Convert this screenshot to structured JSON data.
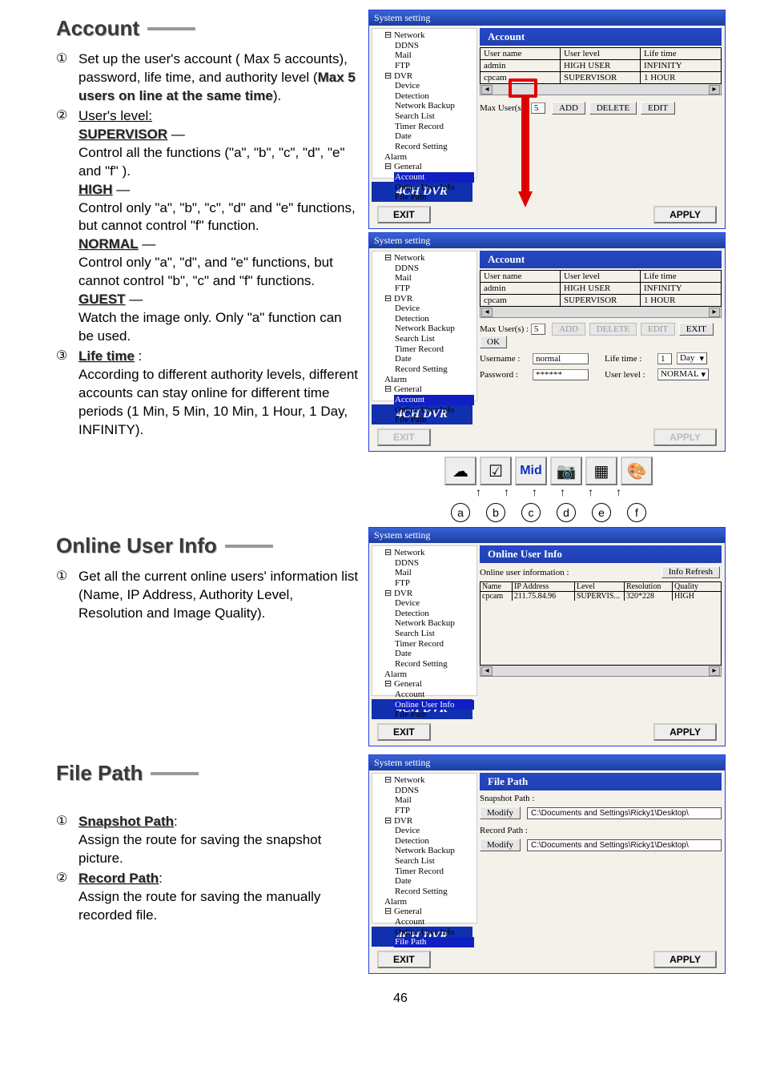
{
  "page_number": "46",
  "account": {
    "title": "Account",
    "item1_num": "①",
    "item1": "Set up the user's account ( Max 5 accounts), password, life time, and authority level (Max 5 users on line at the same time).",
    "item2_num": "②",
    "item2_intro": "User's level:",
    "supervisor_label": "SUPERVISOR",
    "supervisor_body": "Control all the functions (\"a\", \"b\", \"c\", \"d\", \"e\" and \"f\" ).",
    "high_label": "HIGH",
    "high_body": "Control only \"a\", \"b\", \"c\", \"d\" and \"e\" functions, but cannot control \"f\" function.",
    "normal_label": "NORMAL",
    "normal_body": "Control only \"a\", \"d\", and \"e\" functions, but cannot control \"b\", \"c\" and \"f\" functions.",
    "guest_label": "GUEST",
    "guest_body": "Watch the image only. Only \"a\" function can be used.",
    "item3_num": "③",
    "item3_label": "Life time",
    "item3_body": "According to different authority levels, different accounts can stay online for different time periods (1 Min, 5 Min, 10 Min, 1 Hour, 1 Day, INFINITY).",
    "dash": "—"
  },
  "online": {
    "title": "Online User Info",
    "item1_num": "①",
    "item1": "Get all the current online users' information list (Name, IP Address, Authority Level, Resolution and Image Quality)."
  },
  "filepath": {
    "title": "File Path",
    "item1_num": "①",
    "item1_label": "Snapshot Path",
    "item1_body": "Assign the route for saving the snapshot picture.",
    "item2_num": "②",
    "item2_label": "Record Path",
    "item2_body": "Assign the route for saving the manually recorded file."
  },
  "dlg": {
    "window_title": "System setting",
    "logo": "4CH DVR",
    "exit": "EXIT",
    "apply": "APPLY",
    "add": "ADD",
    "delete": "DELETE",
    "edit": "EDIT",
    "ok": "OK",
    "modify": "Modify",
    "info_refresh": "Info Refresh"
  },
  "tree": {
    "network": "Network",
    "ddns": "DDNS",
    "mail": "Mail",
    "ftp": "FTP",
    "dvr": "DVR",
    "device": "Device",
    "detection": "Detection",
    "network_backup": "Network Backup",
    "search_list": "Search List",
    "timer_record": "Timer Record",
    "date": "Date",
    "record_setting": "Record Setting",
    "alarm": "Alarm",
    "general": "General",
    "account": "Account",
    "online_user_info": "Online User Info",
    "file_path": "File Path"
  },
  "account_pane": {
    "title": "Account",
    "col_user": "User name",
    "col_level": "User level",
    "col_life": "Life time",
    "row1_user": "admin",
    "row1_level": "HIGH USER",
    "row1_life": "INFINITY",
    "row2_user": "cpcam",
    "row2_level": "SUPERVISOR",
    "row2_life": "1 HOUR",
    "max_user_label": "Max User(s) :",
    "max_user_value": "5",
    "username_label": "Username :",
    "username_value": "normal",
    "lifetime_label": "Life time :",
    "lifetime_value": "1",
    "lifetime_unit": "Day",
    "password_label": "Password :",
    "password_value": "******",
    "userlevel_label": "User level :",
    "userlevel_value": "NORMAL"
  },
  "online_pane": {
    "title": "Online User Info",
    "info_label": "Online user information :",
    "col_name": "Name",
    "col_ip": "IP Address",
    "col_level": "Level",
    "col_res": "Resolution",
    "col_quality": "Quality",
    "row1_name": "cpcam",
    "row1_ip": "211.75.84.96",
    "row1_level": "SUPERVIS...",
    "row1_res": "320*228",
    "row1_quality": "HIGH"
  },
  "filepath_pane": {
    "title": "File Path",
    "snapshot_label": "Snapshot Path :",
    "record_label": "Record Path :",
    "path_value": "C:\\Documents and Settings\\Ricky1\\Desktop\\"
  },
  "icons": {
    "a": "a",
    "b": "b",
    "c": "c",
    "d": "d",
    "e": "e",
    "f": "f",
    "mid": "Mid"
  }
}
